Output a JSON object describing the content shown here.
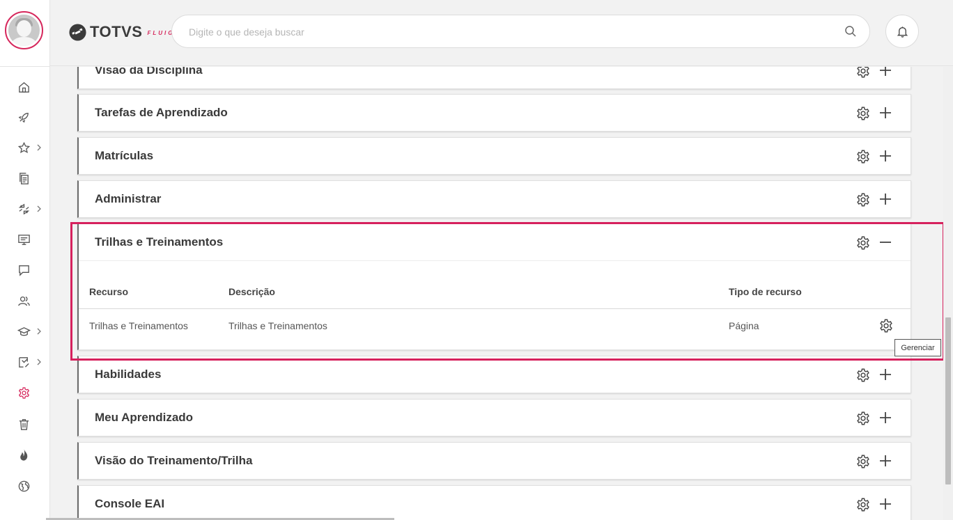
{
  "header": {
    "logo_text": "TOTVS",
    "logo_sub": "FLUIG",
    "search_placeholder": "Digite o que deseja buscar"
  },
  "sidebar": {
    "items": [
      {
        "icon": "home-icon",
        "has_submenu": false,
        "active": false
      },
      {
        "icon": "rocket-icon",
        "has_submenu": false,
        "active": false
      },
      {
        "icon": "star-icon",
        "has_submenu": true,
        "active": false
      },
      {
        "icon": "documents-icon",
        "has_submenu": false,
        "active": false
      },
      {
        "icon": "workflow-icon",
        "has_submenu": true,
        "active": false
      },
      {
        "icon": "presentation-icon",
        "has_submenu": false,
        "active": false
      },
      {
        "icon": "chat-icon",
        "has_submenu": false,
        "active": false
      },
      {
        "icon": "users-icon",
        "has_submenu": false,
        "active": false
      },
      {
        "icon": "graduation-cap-icon",
        "has_submenu": true,
        "active": false
      },
      {
        "icon": "task-icon",
        "has_submenu": true,
        "active": false
      },
      {
        "icon": "gear-icon",
        "has_submenu": false,
        "active": true
      },
      {
        "icon": "trash-icon",
        "has_submenu": false,
        "active": false
      },
      {
        "icon": "flame-icon",
        "has_submenu": false,
        "active": false
      },
      {
        "icon": "globe-icon",
        "has_submenu": false,
        "active": false
      }
    ]
  },
  "panels": [
    {
      "title": "Visão da Disciplina",
      "expanded": false
    },
    {
      "title": "Tarefas de Aprendizado",
      "expanded": false
    },
    {
      "title": "Matrículas",
      "expanded": false
    },
    {
      "title": "Administrar",
      "expanded": false
    },
    {
      "title": "Trilhas e Treinamentos",
      "expanded": true,
      "columns": [
        "Recurso",
        "Descrição",
        "Tipo de recurso"
      ],
      "rows": [
        [
          "Trilhas e Treinamentos",
          "Trilhas e Treinamentos",
          "Página"
        ]
      ]
    },
    {
      "title": "Habilidades",
      "expanded": false
    },
    {
      "title": "Meu Aprendizado",
      "expanded": false
    },
    {
      "title": "Visão do Treinamento/Trilha",
      "expanded": false
    },
    {
      "title": "Console EAI",
      "expanded": false
    }
  ],
  "tooltip": "Gerenciar",
  "colors": {
    "accent": "#d6275c",
    "highlight_border": "#d6215d"
  }
}
